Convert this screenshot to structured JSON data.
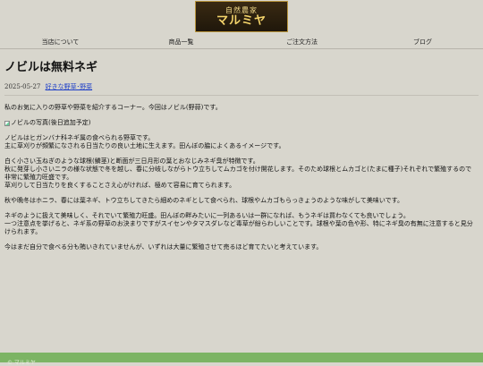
{
  "site": {
    "logo_line1": "自然農家",
    "logo_line2": "マルミヤ"
  },
  "nav": {
    "items": [
      {
        "label": "当店について"
      },
      {
        "label": "商品一覧"
      },
      {
        "label": "ご注文方法"
      },
      {
        "label": "ブログ"
      }
    ]
  },
  "post": {
    "title": "ノビルは無料ネギ",
    "date": "2025-05-27",
    "category": "好きな野草･野菜",
    "intro": "私のお気に入りの野草や野菜を紹介するコーナー。今回はノビル(野蒜)です。",
    "image_alt": "ノビルの写真(後日追加予定)",
    "paragraphs": [
      [
        "ノビルはヒガンバナ科ネギ属の食べられる野草です。",
        "主に草刈りが頻繁になされる日当たりの良い土地に生えます。田んぼの脇によくあるイメージです。"
      ],
      [
        "白く小さい玉ねぎのような球根(鱗茎)と断面が三日月形の葉とおなじみネギ臭が特徴です。",
        "秋に発芽し小さいニラの様な状態で冬を越し、春に分岐しながらトウ立ちしてムカゴを付け開花します。そのため球根とムカゴと(たまに種子)それぞれで繁殖するので非常に繁殖力旺盛です。",
        "草刈りして日当たりを良くすることさえ心がければ、極めて容易に育てられます。"
      ],
      [
        "秋や晩冬はホニラ、春には葉ネギ、トウ立ちしてきたら細めのネギとして食べられ、球根やムカゴもらっきょうのような味がして美味いです。"
      ],
      [
        "ネギのように扱えて美味しく、それでいて繁殖力旺盛。田んぼの畔みたいに一列あるいは一群になれば、もうネギは買わなくても良いでしょう。",
        "一つ注意点を挙げると、ネギ系の野草のお決まりですがスイセンやタマスダレなど毒草が紛らわしいことです。球根や葉の色や形、特にネギ臭の有無に注意すると見分けられます。"
      ],
      [
        "今はまだ自分で食べる分も賄いきれていませんが、いずれは大量に繁殖させて売るほど育てたいと考えています。"
      ]
    ]
  },
  "footer": {
    "text": "© マルミヤ"
  }
}
